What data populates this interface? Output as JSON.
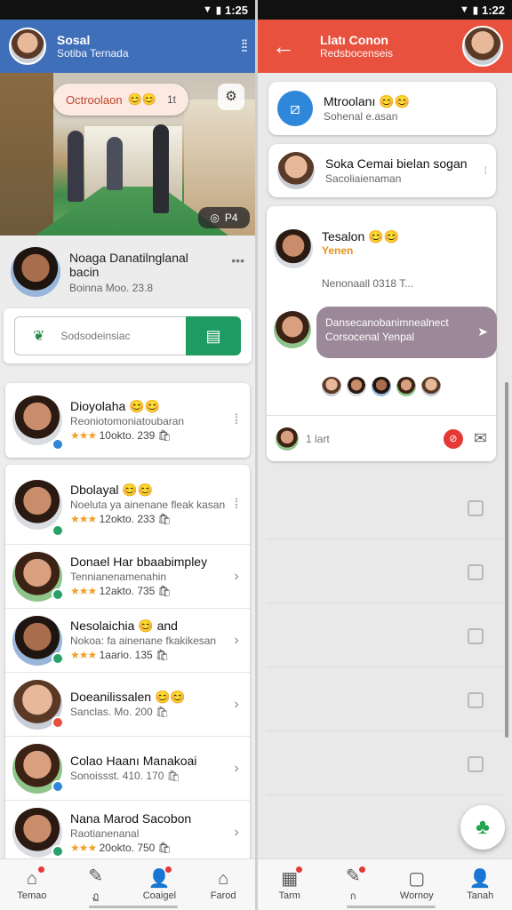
{
  "status": {
    "time_left": "1:25",
    "time_right": "1:22"
  },
  "left": {
    "header": {
      "title": "Sosal",
      "subtitle": "Sotiba Ternada"
    },
    "photo": {
      "pill_text": "Octroolaon",
      "pill_emoji": "😊😊",
      "pill_count": "1t",
      "badge_text": "P4"
    },
    "profile": {
      "name": "Noaga Danatilnglanal bacin",
      "meta": "Boinna Moo. 23.8"
    },
    "search": {
      "placeholder": "Sodsodeinsiac"
    },
    "contacts": [
      {
        "name": "Dioyolaha 😊😊",
        "sub": "Reoniotomoniatoubaran",
        "rating": "★★★",
        "rating_text": "10okto. 239 🛍"
      },
      {
        "name": "Dbolayal 😊😊",
        "sub": "Noeluta ya ainenane fleak kasan",
        "rating": "★★★",
        "rating_text": "12okto. 233 🛍"
      },
      {
        "name": "Donael Har bbaabimpley",
        "sub": "Tennianenamenahin",
        "rating": "★★★",
        "rating_text": "12akto. 735 🛍"
      },
      {
        "name": "Nesolaichia 😊 and",
        "sub": "Nokoa: fa ainenane fkakikesan",
        "rating": "★★★",
        "rating_text": "1aario. 135 🛍"
      },
      {
        "name": "Doeanilissalen 😊😊",
        "sub": "Sanclas. Mo. 200 🛍",
        "rating": "",
        "rating_text": ""
      },
      {
        "name": "Colao Haanı Manakoai",
        "sub": "Sonoissst. 410. 170 🛍",
        "rating": "",
        "rating_text": ""
      },
      {
        "name": "Nana Marod Sacobon",
        "sub": "Raotianenanal",
        "rating": "★★★",
        "rating_text": "20okto. 750 🛍"
      }
    ],
    "nav": [
      {
        "label": "Temao",
        "icon": "home-icon"
      },
      {
        "label": "ฏ",
        "icon": "feather-icon"
      },
      {
        "label": "Coaigel",
        "icon": "people-icon"
      },
      {
        "label": "Farod",
        "icon": "house-icon"
      }
    ]
  },
  "right": {
    "header": {
      "title": "Llatı Conon",
      "subtitle": "Redsbocenseis"
    },
    "chat_top": {
      "name": "Mtroolanı 😊😊",
      "sub": "Sohenal e.asan"
    },
    "chat_item": {
      "name": "Soka Cemai bielan sogan",
      "sub": "Sacoliaienaman"
    },
    "message": {
      "name": "Tesalon 😊😊",
      "tag": "Yenen",
      "meta": "Nenonaall 0318 T..."
    },
    "bubble_text": "Dansecanobanimnealnect Corsocenal Yenpal",
    "compose_placeholder": "1 lart",
    "nav": [
      {
        "label": "Tarm",
        "icon": "calendar-icon"
      },
      {
        "label": "ก",
        "icon": "feather-icon"
      },
      {
        "label": "Wornoy",
        "icon": "square-icon"
      },
      {
        "label": "Tanah",
        "icon": "person-icon"
      }
    ]
  },
  "colors": {
    "left_header": "#3f6fb8",
    "right_header": "#e8513d",
    "accent_green": "#1f9a62"
  }
}
